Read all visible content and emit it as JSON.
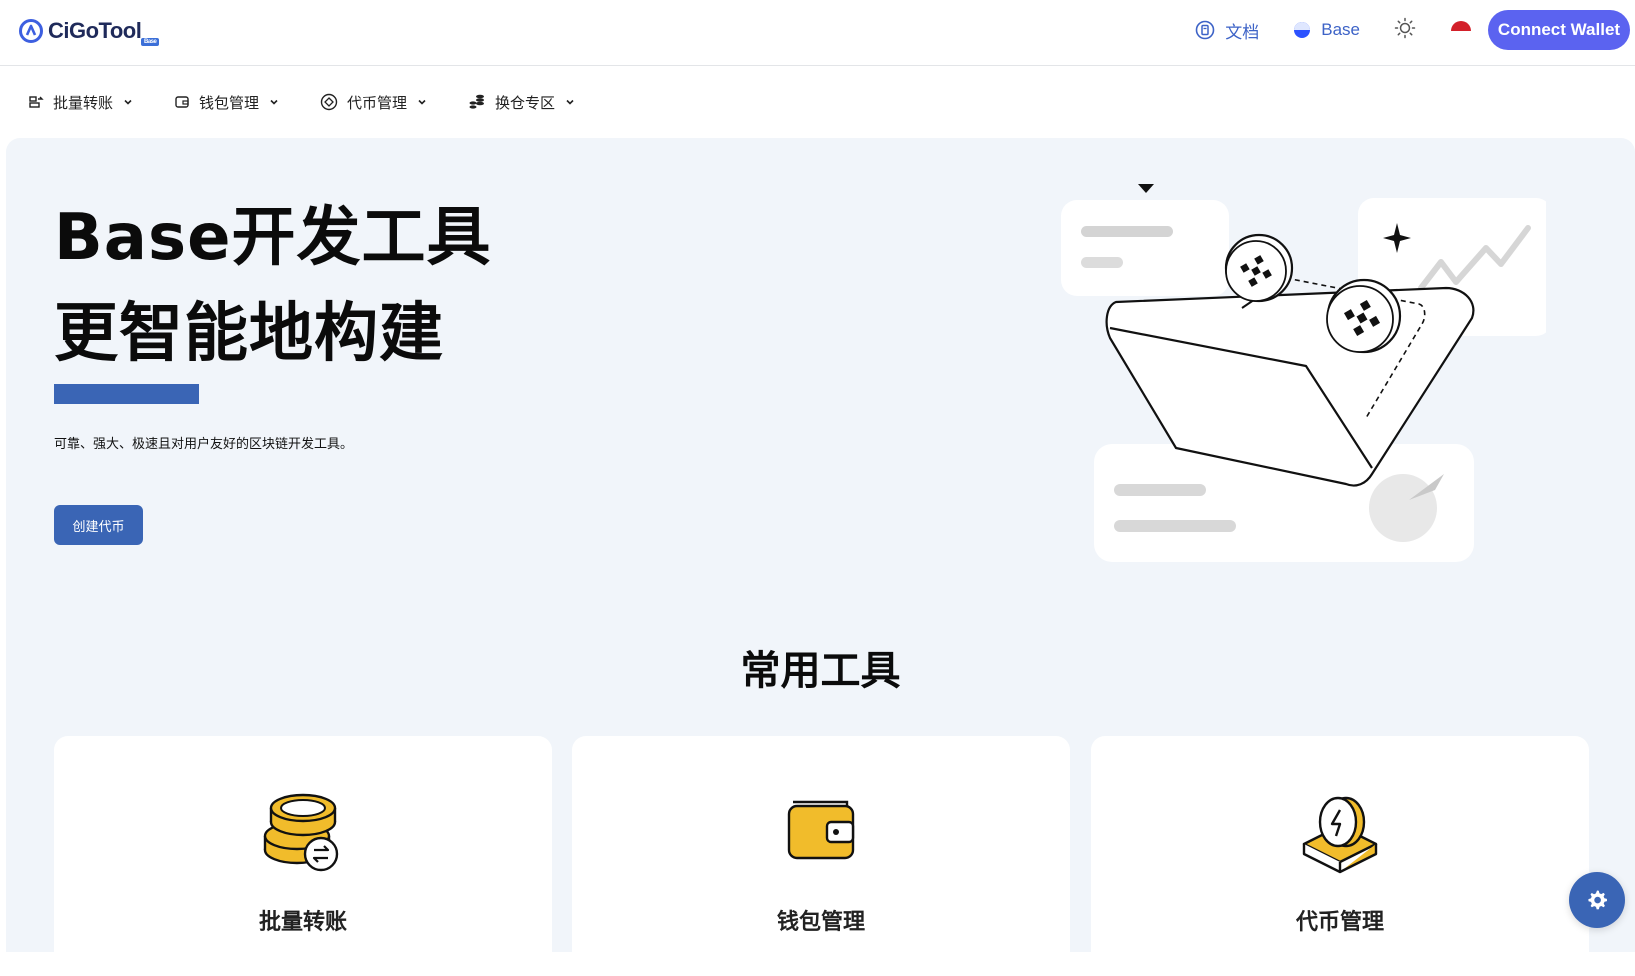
{
  "header": {
    "logo_text": "CiGoTool",
    "logo_badge": "Base",
    "docs_label": "文档",
    "network_label": "Base",
    "connect_label": "Connect Wallet"
  },
  "nav": {
    "items": [
      {
        "label": "批量转账",
        "icon": "transfer-icon"
      },
      {
        "label": "钱包管理",
        "icon": "wallet-icon"
      },
      {
        "label": "代币管理",
        "icon": "token-icon"
      },
      {
        "label": "换仓专区",
        "icon": "coins-stack-icon"
      }
    ]
  },
  "hero": {
    "title_line1": "Base开发工具",
    "title_line2": "更智能地构建",
    "description": "可靠、强大、极速且对用户友好的区块链开发工具。",
    "cta_label": "创建代币"
  },
  "tools": {
    "section_title": "常用工具",
    "cards": [
      {
        "title": "批量转账",
        "icon": "coins-transfer-icon"
      },
      {
        "title": "钱包管理",
        "icon": "wallet-icon"
      },
      {
        "title": "代币管理",
        "icon": "token-box-icon"
      }
    ]
  },
  "colors": {
    "primary": "#3a65b5",
    "connect": "#5b63f0",
    "link": "#3d63c7",
    "background": "#f1f5fa",
    "coin": "#f1bc2b"
  }
}
